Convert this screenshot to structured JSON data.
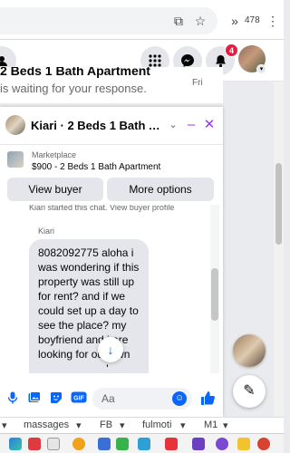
{
  "browser": {
    "tab_count": "478",
    "icons": [
      "cast-icon",
      "star-icon",
      "extensions-overflow-icon",
      "kebab-menu-icon"
    ]
  },
  "header": {
    "notification_count": "4",
    "icons": [
      "grid-menu-icon",
      "messenger-icon",
      "bell-icon"
    ]
  },
  "notification": {
    "title": "2 Beds 1 Bath Apartment",
    "subtitle": "is waiting for your response.",
    "time": "Fri"
  },
  "chat": {
    "title": "Kiari · 2 Beds 1 Bath Apart...",
    "marketplace_label": "Marketplace",
    "listing": "$900 - 2 Beds 1 Bath Apartment",
    "view_buyer_label": "View buyer",
    "more_options_label": "More options",
    "started_text": "Kiari started this chat. View buyer profile",
    "sender": "Kiari",
    "message": "8082092775 aloha i was wondering if this property was still up for rent? and if we could set up a day to see the place? my boyfriend and i are looking for our own place! Mahalo!",
    "composer_placeholder": "Aa"
  },
  "bookmarks": [
    "massages",
    "FB",
    "fulmoti",
    "M1"
  ],
  "colors": {
    "accent": "#0866ff",
    "chat_header_accent": "#a033ff",
    "badge": "#e41e3f"
  }
}
